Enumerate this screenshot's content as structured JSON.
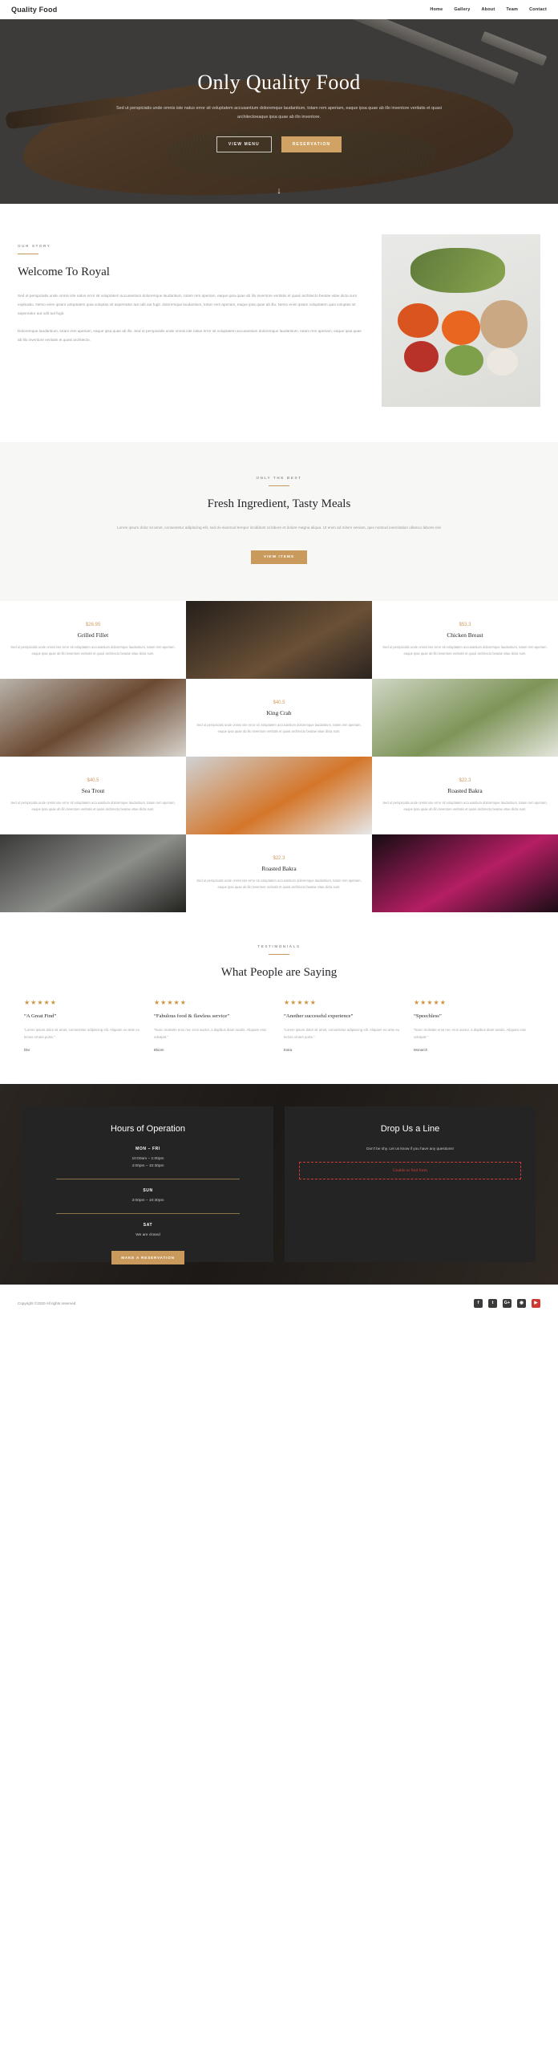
{
  "header": {
    "brand": "Quality Food",
    "nav": [
      {
        "label": "Home"
      },
      {
        "label": "Gallery"
      },
      {
        "label": "About"
      },
      {
        "label": "Team"
      },
      {
        "label": "Contact"
      }
    ]
  },
  "hero": {
    "title": "Only Quality Food",
    "subtitle": "Sed ut perspiciatis unde omnis iste natus error sit voluptatem accusantium doloremque laudantium, totam rem aperiam, eaque ipsa quae ab illo inventore veritatis et quasi architectoeaque ipsa quae ab illo inventore.",
    "btn_menu": "VIEW MENU",
    "btn_reservation": "RESERVATION",
    "scroll_icon": "down-arrow-icon"
  },
  "welcome": {
    "eyebrow": "OUR STORY",
    "title": "Welcome To Royal",
    "para1": "Sed ut perspiciatis unde omnis iste natus error sit voluptatem accusantium doloremque laudantium, totam rem aperiam, eaque ipsa quae ab illo inventore veritatis et quasi architecto beatae vitae dicta sunt explicabo. Nemo enim ipsam voluptatem quia voluptas sit aspernatur aut odit aut fugit. doloremque laudantium, totam rem aperiam, eaque ipsa quae ab illo. Nemo enim ipsam voluptatem quia voluptas sit aspernatur aut odit aut fugit.",
    "para2": "Doloremque laudantium, totam rem aperiam, eaque ipsa quae ab illo. Sed ut perspiciatis unde omnis iste natus error sit voluptatem accusantium doloremque laudantium, totam rem aperiam, eaque ipsa quae ab illo inventore veritatis et quasi architecto."
  },
  "fresh": {
    "eyebrow": "ONLY THE BEST",
    "title": "Fresh Ingredient, Tasty Meals",
    "para": "Lorem ipsum dolor sit amet, consectetur adipiscing elit, sed do eiusmod tempor incididunt ut labore et dolore magna aliqua. Ut enim ad minim veniam, quis nostrud exercitation ullamco laboris nisi",
    "btn": "VIEW ITEMS"
  },
  "menu": {
    "desc": "Sed ut perspiciatis unde omnis iste error sit voluptatem accusantium doloremque laudantium, totam rem aperiam, eaque ipsa quae ab illo inventore veritatis et quasi architecto beatae vitae dicta sunt.",
    "items": [
      {
        "price": "$26.95",
        "name": "Grilled Fillet"
      },
      {
        "price": "$53.3",
        "name": "Chicken Breast"
      },
      {
        "price": "$40.5",
        "name": "King Crab"
      },
      {
        "price": "$40.5",
        "name": "Sea Trout"
      },
      {
        "price": "$22.3",
        "name": "Roasted Bakra"
      },
      {
        "price": "$22.3",
        "name": "Roasted Bakra"
      }
    ]
  },
  "testimonials": {
    "eyebrow": "TESTIMONIALS",
    "title": "What People are Saying",
    "stars": "★★★★★",
    "cards": [
      {
        "title": "“A Great Find”",
        "quote": "“Lorem ipsum dolor sit amet, consectetur adipiscing elit. Aliquam eu ante eu lectus ornare porta.”",
        "name": "Divi"
      },
      {
        "title": "“Fabulous food & flawless service”",
        "quote": "“Nunc molestie eros nec eros auctor, a dapibus diam iaculis. Aliquam erat volutpat.”",
        "name": "Bloom"
      },
      {
        "title": "“Another successful experience”",
        "quote": "“Lorem ipsum dolor sit amet, consectetur adipiscing elit. Aliquam eu ante eu lectus ornare porta.”",
        "name": "Extra"
      },
      {
        "title": "“Speechless”",
        "quote": "“Nunc molestie eros nec eros auctor, a dapibus diam iaculis. Aliquam erat volutpat.”",
        "name": "Monarch"
      }
    ]
  },
  "contact": {
    "hours": {
      "title": "Hours of Operation",
      "rows": [
        {
          "day": "MON – FRI",
          "times": "10:00am – 1:00pm\n4:00pm – 10:30pm"
        },
        {
          "day": "SUN",
          "times": "3:00pm – 10:30pm"
        },
        {
          "day": "SAT",
          "times": "We are closed"
        }
      ],
      "btn": "MAKE A RESERVATION"
    },
    "form": {
      "title": "Drop Us a Line",
      "subtitle": "Don't be shy. Let us know if you have any questions!",
      "error": "Unable to find form"
    }
  },
  "footer": {
    "copyright": "Copyright ©2020 All rights reserved",
    "socials": [
      {
        "icon": "facebook-icon",
        "glyph": "f"
      },
      {
        "icon": "twitter-icon",
        "glyph": "t"
      },
      {
        "icon": "google-plus-icon",
        "glyph": "G+"
      },
      {
        "icon": "instagram-icon",
        "glyph": "◉"
      },
      {
        "icon": "youtube-icon",
        "glyph": "▶"
      }
    ]
  }
}
